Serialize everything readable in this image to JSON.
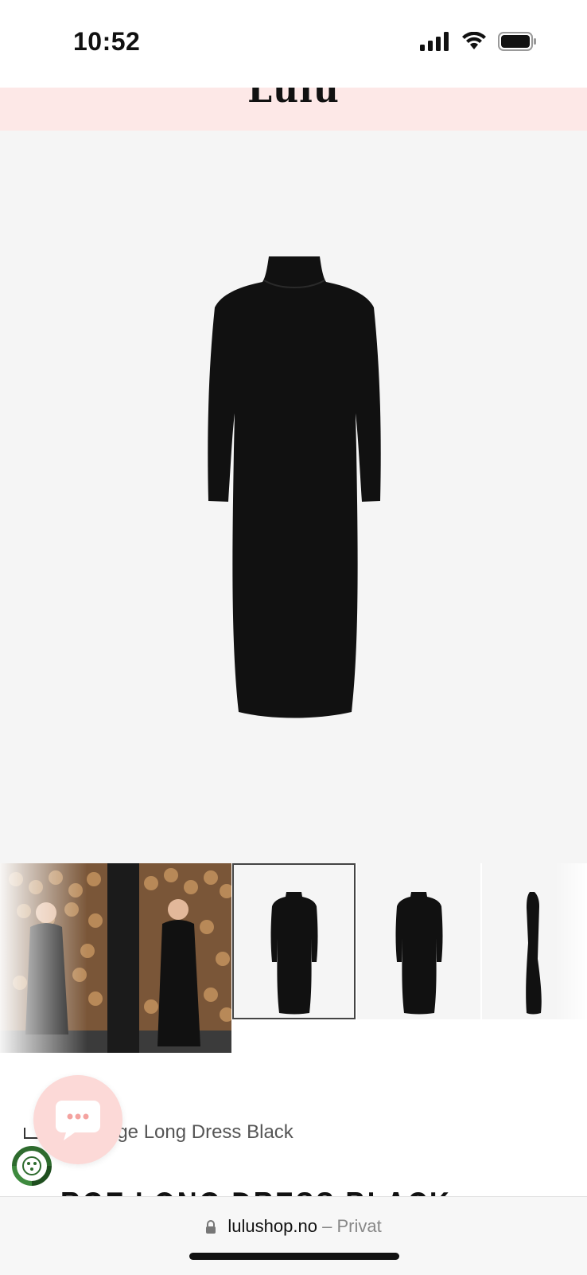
{
  "status_bar": {
    "time": "10:52",
    "icons": [
      "cellular-signal-icon",
      "wifi-icon",
      "battery-icon"
    ]
  },
  "store": {
    "logo_text": "Lulu",
    "header_color": "#fde8e7"
  },
  "product": {
    "main_image": "black-long-dress-image",
    "thumbnails": [
      "lifestyle-photo",
      "dress-front",
      "dress-front-alt",
      "dress-side"
    ],
    "selected_thumbnail": 1,
    "title": "RGE LONG DRESS BLACK"
  },
  "breadcrumb": {
    "visible_text": "rge Long Dress Black"
  },
  "chat": {
    "icon": "chat-bubble-icon",
    "color": "#fcd9d7"
  },
  "browser": {
    "domain": "lulushop.no",
    "separator": "–",
    "privacy_label": "Privat"
  }
}
